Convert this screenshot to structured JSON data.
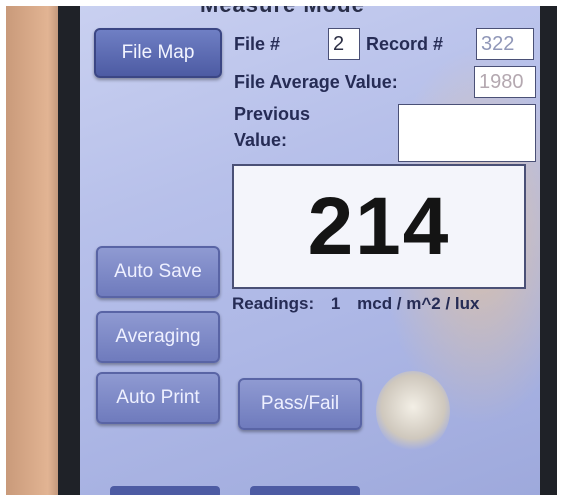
{
  "header": {
    "title_partial": "Measure Mode"
  },
  "buttons": {
    "file_map": "File Map",
    "auto_save": "Auto Save",
    "averaging": "Averaging",
    "auto_print": "Auto Print",
    "pass_fail": "Pass/Fail"
  },
  "fields": {
    "file_label": "File #",
    "file_value": "2",
    "record_label": "Record #",
    "record_value": "322",
    "file_average_label": "File Average Value:",
    "file_average_value": "1980",
    "previous_label_line1": "Previous",
    "previous_label_line2": "Value:",
    "previous_value": ""
  },
  "reading": {
    "value": "214",
    "readings_label": "Readings:",
    "readings_count": "1",
    "units": "mcd / m^2 / lux"
  },
  "colors": {
    "screen_bg": "#b7c0ea",
    "button_bg": "#5a68ae",
    "text_dark": "#262c55"
  }
}
